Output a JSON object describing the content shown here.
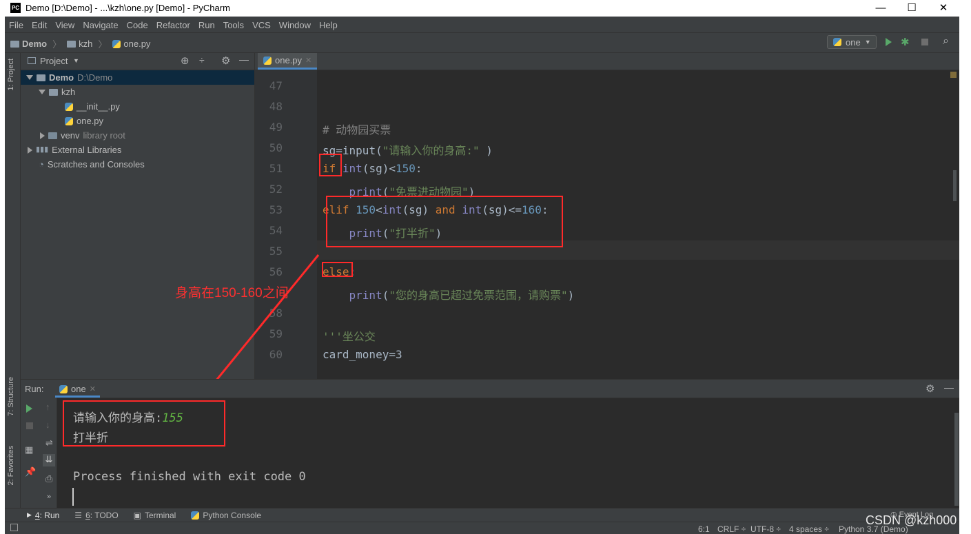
{
  "window": {
    "title": "Demo [D:\\Demo] - ...\\kzh\\one.py [Demo] - PyCharm",
    "logo_text": "PC",
    "minimize": "—",
    "maximize": "☐",
    "close": "✕"
  },
  "menu": [
    "File",
    "Edit",
    "View",
    "Navigate",
    "Code",
    "Refactor",
    "Run",
    "Tools",
    "VCS",
    "Window",
    "Help"
  ],
  "breadcrumb": [
    "Demo",
    "kzh",
    "one.py"
  ],
  "run_config": {
    "name": "one"
  },
  "left_strip": {
    "project_tab": "1: Project",
    "structure_tab": "7: Structure",
    "favorites_tab": "2: Favorites"
  },
  "project": {
    "header": "Project",
    "tree": [
      {
        "name": "Demo",
        "hint": "D:\\Demo"
      },
      {
        "name": "kzh",
        "hint": ""
      },
      {
        "name": "__init__.py",
        "hint": ""
      },
      {
        "name": "one.py",
        "hint": ""
      },
      {
        "name": "venv",
        "hint": "library root"
      },
      {
        "name": "External Libraries",
        "hint": ""
      },
      {
        "name": "Scratches and Consoles",
        "hint": ""
      }
    ]
  },
  "editor": {
    "tab": "one.py",
    "lines": [
      "47",
      "48",
      "49",
      "50",
      "51",
      "52",
      "53",
      "54",
      "55",
      "56",
      "",
      "58",
      "59",
      "60"
    ],
    "code": {
      "l49_comment": "# 动物园买票",
      "l50_a": "sg=",
      "l50_b": "input",
      "l50_c": "(",
      "l50_str": "\"请输入你的身高:\"",
      "l50_d": " )",
      "l51_kw": "if",
      "l51_a": " ",
      "l51_bi": "int",
      "l51_b": "(sg)<",
      "l51_num": "150",
      "l51_c": ":",
      "l52_a": "    ",
      "l52_bi": "print",
      "l52_b": "(",
      "l52_str": "\"免票进动物园\"",
      "l52_c": ")",
      "l53_kw": "elif",
      "l53_num1": " 150",
      "l53_a": "<",
      "l53_bi1": "int",
      "l53_b": "(sg) ",
      "l53_kw2": "and",
      "l53_c": " ",
      "l53_bi2": "int",
      "l53_d": "(sg)<=",
      "l53_num2": "160",
      "l53_e": ":",
      "l54_a": "    ",
      "l54_bi": "print",
      "l54_b": "(",
      "l54_str": "\"打半折\"",
      "l54_c": ")",
      "l56_kw": "else",
      "l56_a": ":",
      "l57_a": "    ",
      "l57_bi": "print",
      "l57_b": "(",
      "l57_str": "\"您的身高已超过免票范围，请购票\"",
      "l57_c": ")",
      "l59_str": "'''坐公交",
      "l60": "card_money=3"
    }
  },
  "annotation": "身高在150-160之间",
  "run": {
    "label": "Run:",
    "tab": "one",
    "output": {
      "prompt": "请输入你的身高:",
      "input": "155",
      "result": "打半折",
      "finished": "Process finished with exit code 0"
    }
  },
  "tool_tabs": [
    {
      "num": "4",
      "label": ": Run"
    },
    {
      "num": "6",
      "label": ": TODO"
    },
    {
      "num": "",
      "label": "Terminal"
    },
    {
      "num": "",
      "label": "Python Console"
    }
  ],
  "event_log": "Event Log",
  "status": {
    "position": "6:1",
    "line_sep": "CRLF ÷",
    "encoding": "UTF-8 ÷",
    "indent": "4 spaces ÷",
    "interpreter": "Python 3.7 (Demo)"
  },
  "watermark": "CSDN @kzh000"
}
